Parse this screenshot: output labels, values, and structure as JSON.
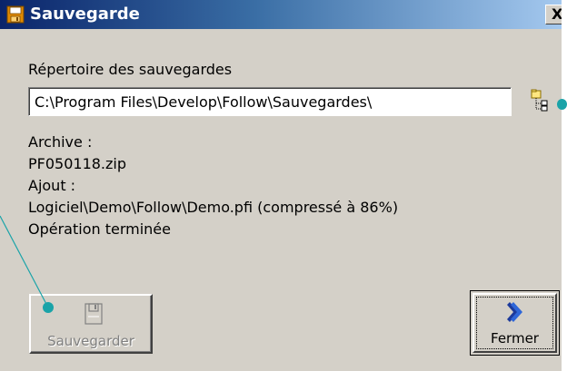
{
  "window": {
    "title": "Sauvegarde",
    "close_glyph": "X"
  },
  "backup_dir": {
    "label": "Répertoire des sauvegardes",
    "value": "C:\\Program Files\\Develop\\Follow\\Sauvegardes\\"
  },
  "log": {
    "archive_label": "Archive :",
    "archive_name": "PF050118.zip",
    "add_label": "Ajout :",
    "added_file": "Logiciel\\Demo\\Follow\\Demo.pfi (compressé à 86%)",
    "status": "Opération terminée"
  },
  "buttons": {
    "save_label": "Sauvegarder",
    "close_label": "Fermer"
  },
  "icons": {
    "title": "floppy-disk-icon",
    "browse": "folder-tree-icon",
    "save": "floppy-disk-icon",
    "close": "chevron-right-icon"
  },
  "colors": {
    "titlebar_start": "#0a246a",
    "titlebar_end": "#a6caf0",
    "dialog_bg": "#d4d0c8",
    "callout": "#1aa3a8"
  }
}
